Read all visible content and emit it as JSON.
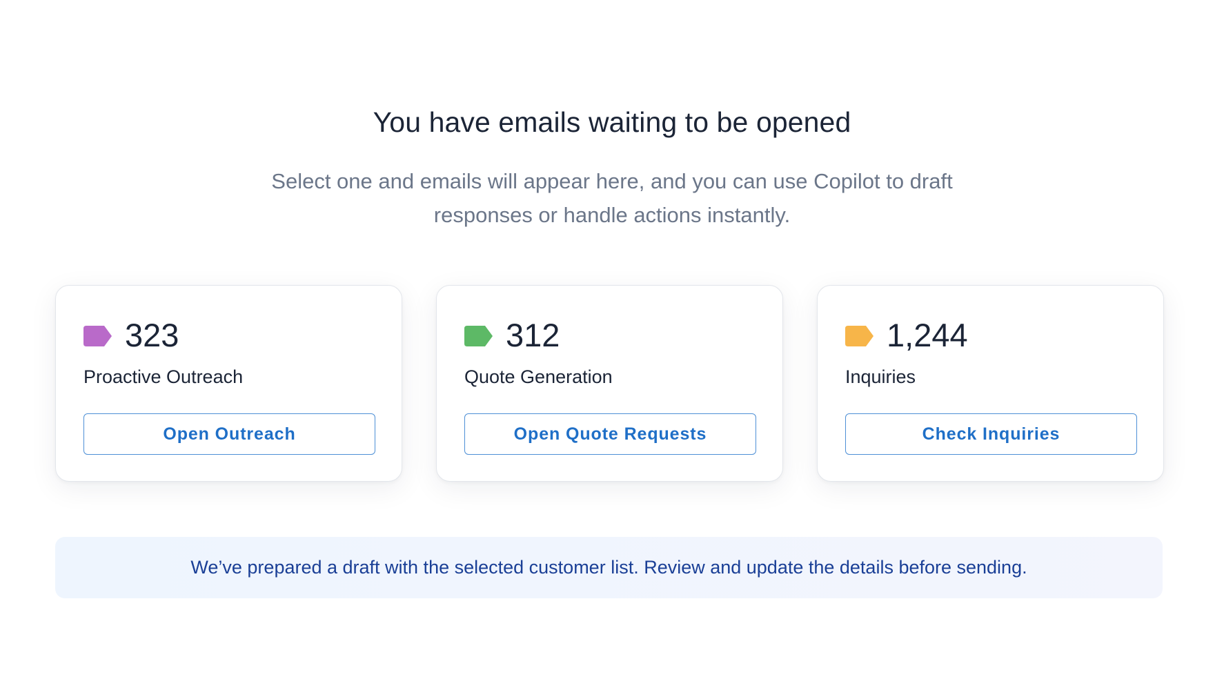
{
  "header": {
    "title": "You have emails waiting to be opened",
    "subtitle": "Select one and emails will appear here, and you can use Copilot to draft responses or handle actions instantly."
  },
  "cards": [
    {
      "count": "323",
      "label": "Proactive Outreach",
      "button_label": "Open Outreach",
      "tag_icon": "tag-icon",
      "tag_color": "#b96ac9"
    },
    {
      "count": "312",
      "label": "Quote Generation",
      "button_label": "Open Quote Requests",
      "tag_icon": "tag-icon",
      "tag_color": "#5db966"
    },
    {
      "count": "1,244",
      "label": "Inquiries",
      "button_label": "Check Inquiries",
      "tag_icon": "tag-icon",
      "tag_color": "#f7b549"
    }
  ],
  "notice": {
    "text": "We’ve prepared a draft with the selected customer list. Review and update the details before sending."
  },
  "colors": {
    "accent": "#1f6fc7",
    "notice_text": "#1a3f96"
  }
}
